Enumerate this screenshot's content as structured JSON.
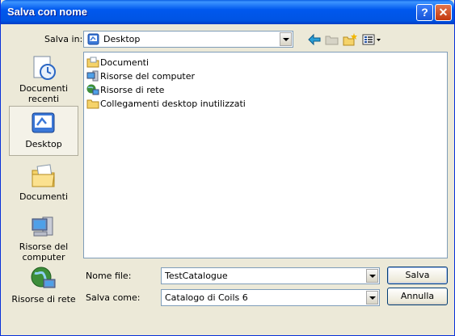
{
  "window": {
    "title": "Salva con nome"
  },
  "save_in": {
    "label": "Salva in:",
    "value": "Desktop"
  },
  "toolbar": {
    "back_icon": "back-arrow-icon",
    "up_icon": "up-folder-icon",
    "new_folder_icon": "new-folder-icon",
    "view_menu_icon": "view-menu-icon"
  },
  "places": [
    {
      "label": "Documenti recenti",
      "icon": "recent-documents-icon"
    },
    {
      "label": "Desktop",
      "icon": "desktop-icon"
    },
    {
      "label": "Documenti",
      "icon": "documents-icon"
    },
    {
      "label": "Risorse del computer",
      "icon": "my-computer-icon"
    },
    {
      "label": "Risorse di rete",
      "icon": "network-icon"
    }
  ],
  "files": [
    {
      "name": "Documenti",
      "icon": "folder-documents-icon"
    },
    {
      "name": "Risorse del computer",
      "icon": "computer-icon"
    },
    {
      "name": "Risorse di rete",
      "icon": "network-icon"
    },
    {
      "name": "Collegamenti desktop inutilizzati",
      "icon": "folder-icon"
    }
  ],
  "filename": {
    "label": "Nome file:",
    "value": "TestCatalogue"
  },
  "filetype": {
    "label": "Salva come:",
    "value": "Catalogo di Coils 6"
  },
  "buttons": {
    "save": "Salva",
    "cancel": "Annulla"
  },
  "colors": {
    "titlebar": "#0054e3",
    "window_bg": "#ece9d8",
    "field_border": "#7f9db9"
  }
}
